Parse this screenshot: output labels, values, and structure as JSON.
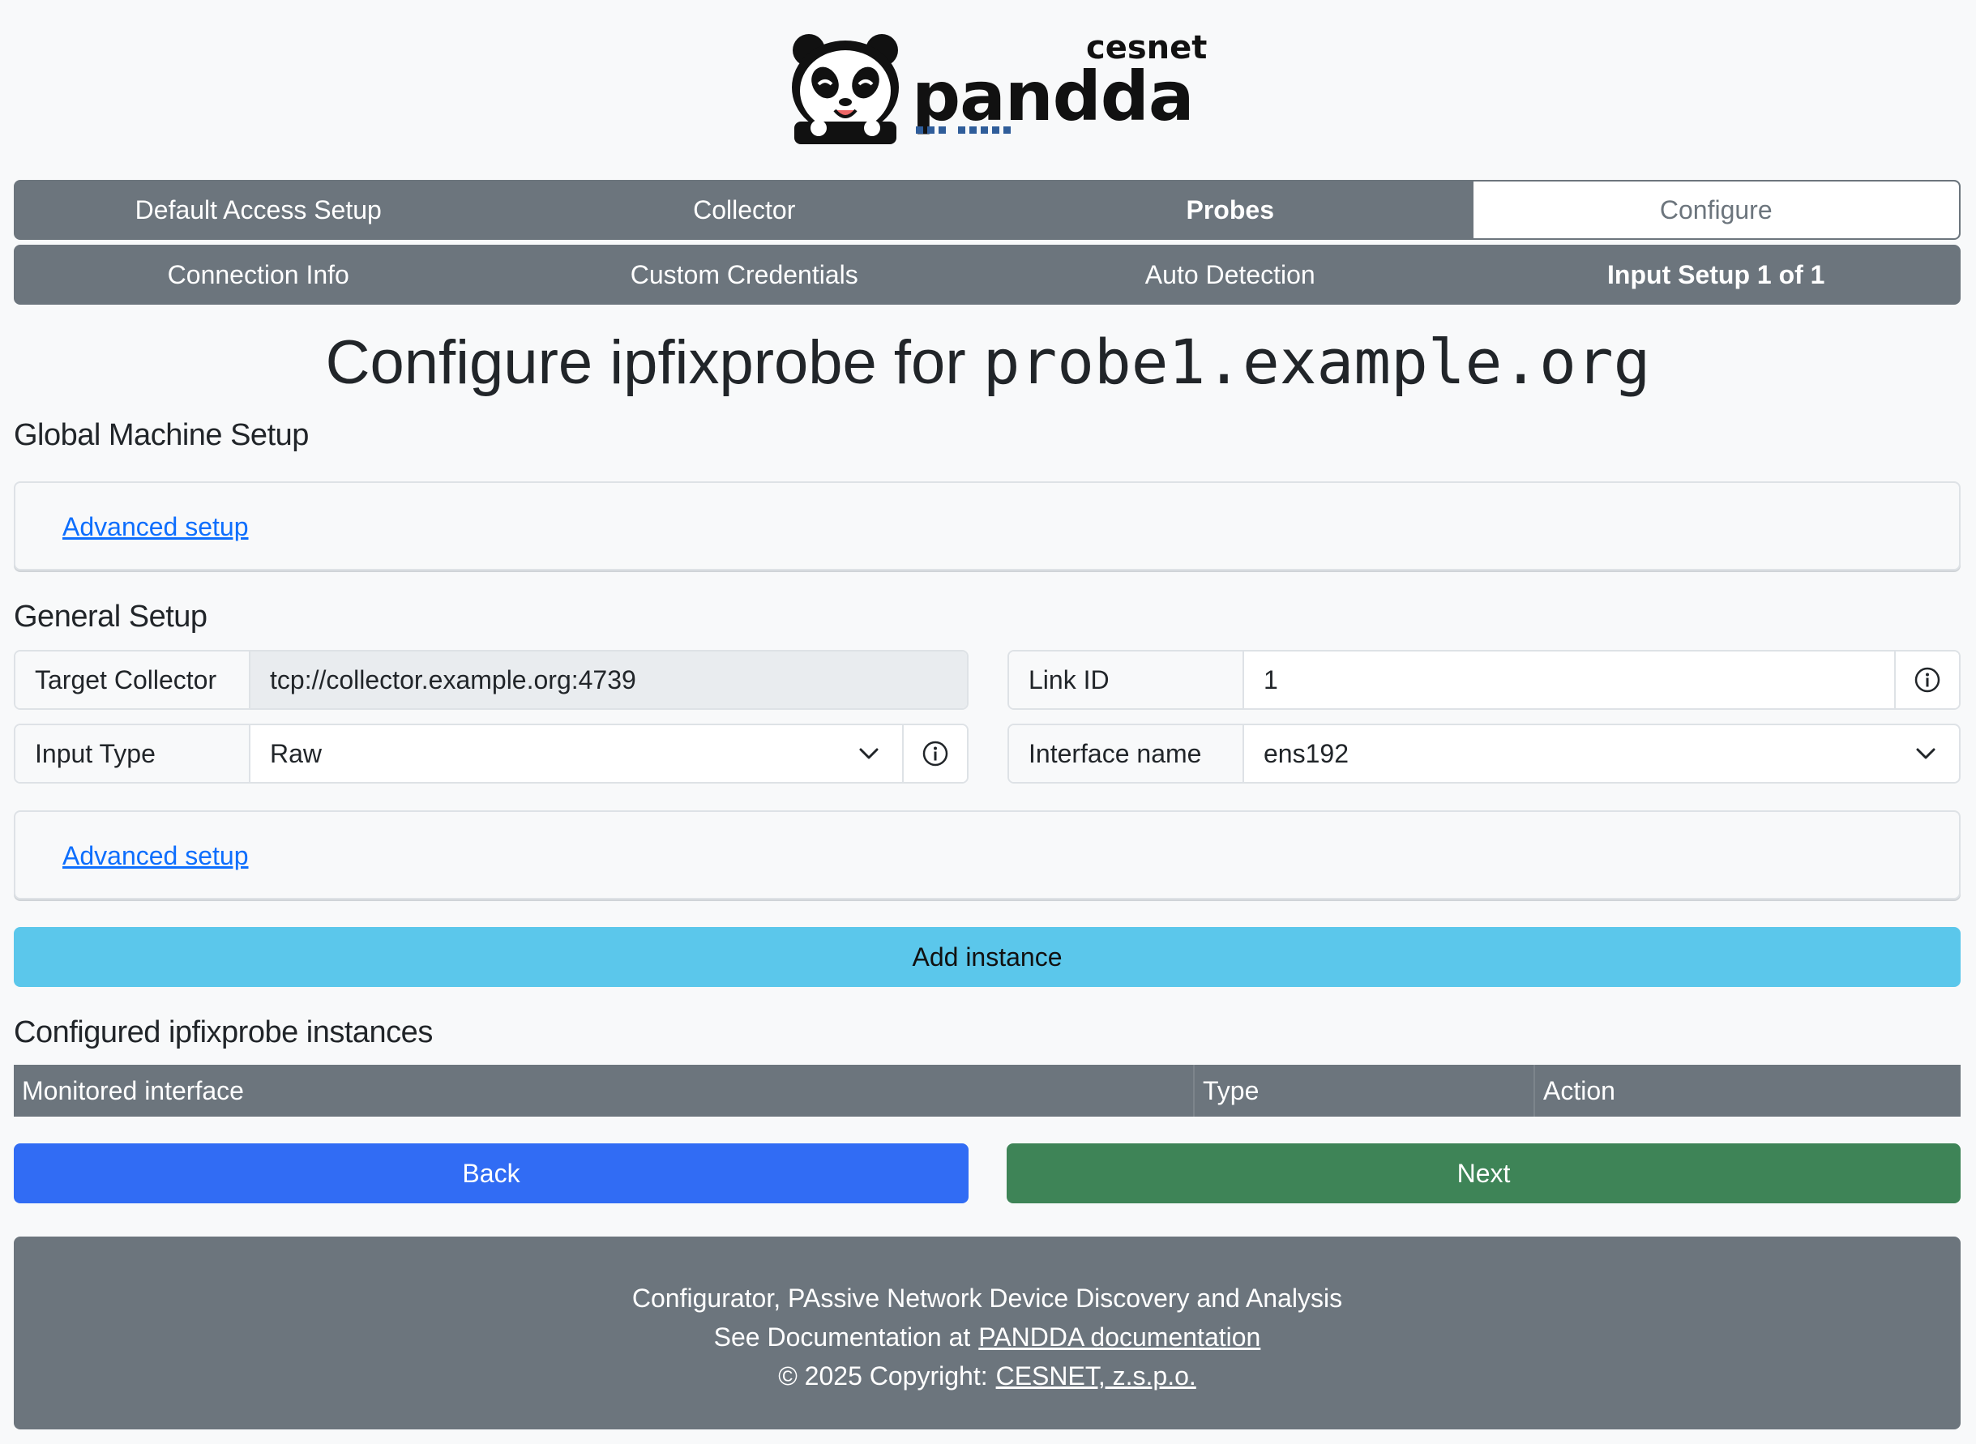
{
  "logo": {
    "name": "pandda",
    "org": "cesnet"
  },
  "wizard": {
    "steps": [
      {
        "label": "Default Access Setup"
      },
      {
        "label": "Collector"
      },
      {
        "label": "Probes"
      },
      {
        "label": "Configure"
      }
    ],
    "substeps": [
      {
        "label": "Connection Info"
      },
      {
        "label": "Custom Credentials"
      },
      {
        "label": "Auto Detection"
      },
      {
        "label": "Input Setup 1 of 1"
      }
    ]
  },
  "page": {
    "title_prefix": "Configure ipfixprobe for ",
    "title_host": "probe1.example.org"
  },
  "global_setup": {
    "heading": "Global Machine Setup",
    "advanced_link": "Advanced setup"
  },
  "general_setup": {
    "heading": "General Setup",
    "target_collector_label": "Target Collector",
    "target_collector_value": "tcp://collector.example.org:4739",
    "link_id_label": "Link ID",
    "link_id_value": "1",
    "input_type_label": "Input Type",
    "input_type_value": "Raw",
    "interface_name_label": "Interface name",
    "interface_name_value": "ens192",
    "advanced_link": "Advanced setup",
    "add_instance_label": "Add instance"
  },
  "instances": {
    "heading": "Configured ipfixprobe instances",
    "columns": [
      "Monitored interface",
      "Type",
      "Action"
    ]
  },
  "nav": {
    "back_label": "Back",
    "next_label": "Next"
  },
  "footer": {
    "line1": "Configurator, PAssive Network Device Discovery and Analysis",
    "line2_prefix": "See Documentation at",
    "docs_link": "PANDDA documentation",
    "line3_prefix": "© 2025 Copyright:",
    "org_link": "CESNET, z.s.p.o."
  },
  "colors": {
    "stepbar": "#6c757d",
    "link": "#0d6efd",
    "add_instance": "#5bc7eb",
    "back": "#316cf4",
    "next": "#3e8457"
  },
  "icons": {
    "info": "info-icon",
    "dropdown": "chevron-down-icon",
    "logo": "panda-logo-icon"
  }
}
